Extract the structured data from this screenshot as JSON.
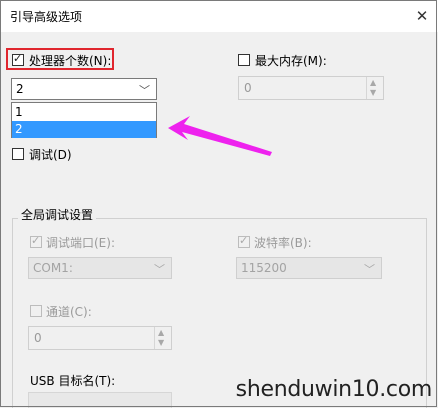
{
  "window": {
    "title": "引导高级选项",
    "close_glyph": "✕"
  },
  "processors": {
    "label": "处理器个数(N):",
    "checked": true,
    "selected": "2",
    "options": [
      "1",
      "2"
    ],
    "highlighted": "2"
  },
  "max_memory": {
    "label": "最大内存(M):",
    "checked": false,
    "value": "0"
  },
  "debug": {
    "label": "调试(D)",
    "checked": false
  },
  "global_debug": {
    "title": "全局调试设置",
    "debug_port": {
      "label": "调试端口(E):",
      "checked": true,
      "value": "COM1:"
    },
    "baud_rate": {
      "label": "波特率(B):",
      "checked": true,
      "value": "115200"
    },
    "channel": {
      "label": "通道(C):",
      "checked": false,
      "value": "0"
    },
    "usb_target": {
      "label": "USB 目标名(T):"
    }
  },
  "annotation": {
    "arrow_color": "#ee22ee",
    "highlight_color": "#e0262e"
  },
  "watermark": "shenduwin10.com"
}
